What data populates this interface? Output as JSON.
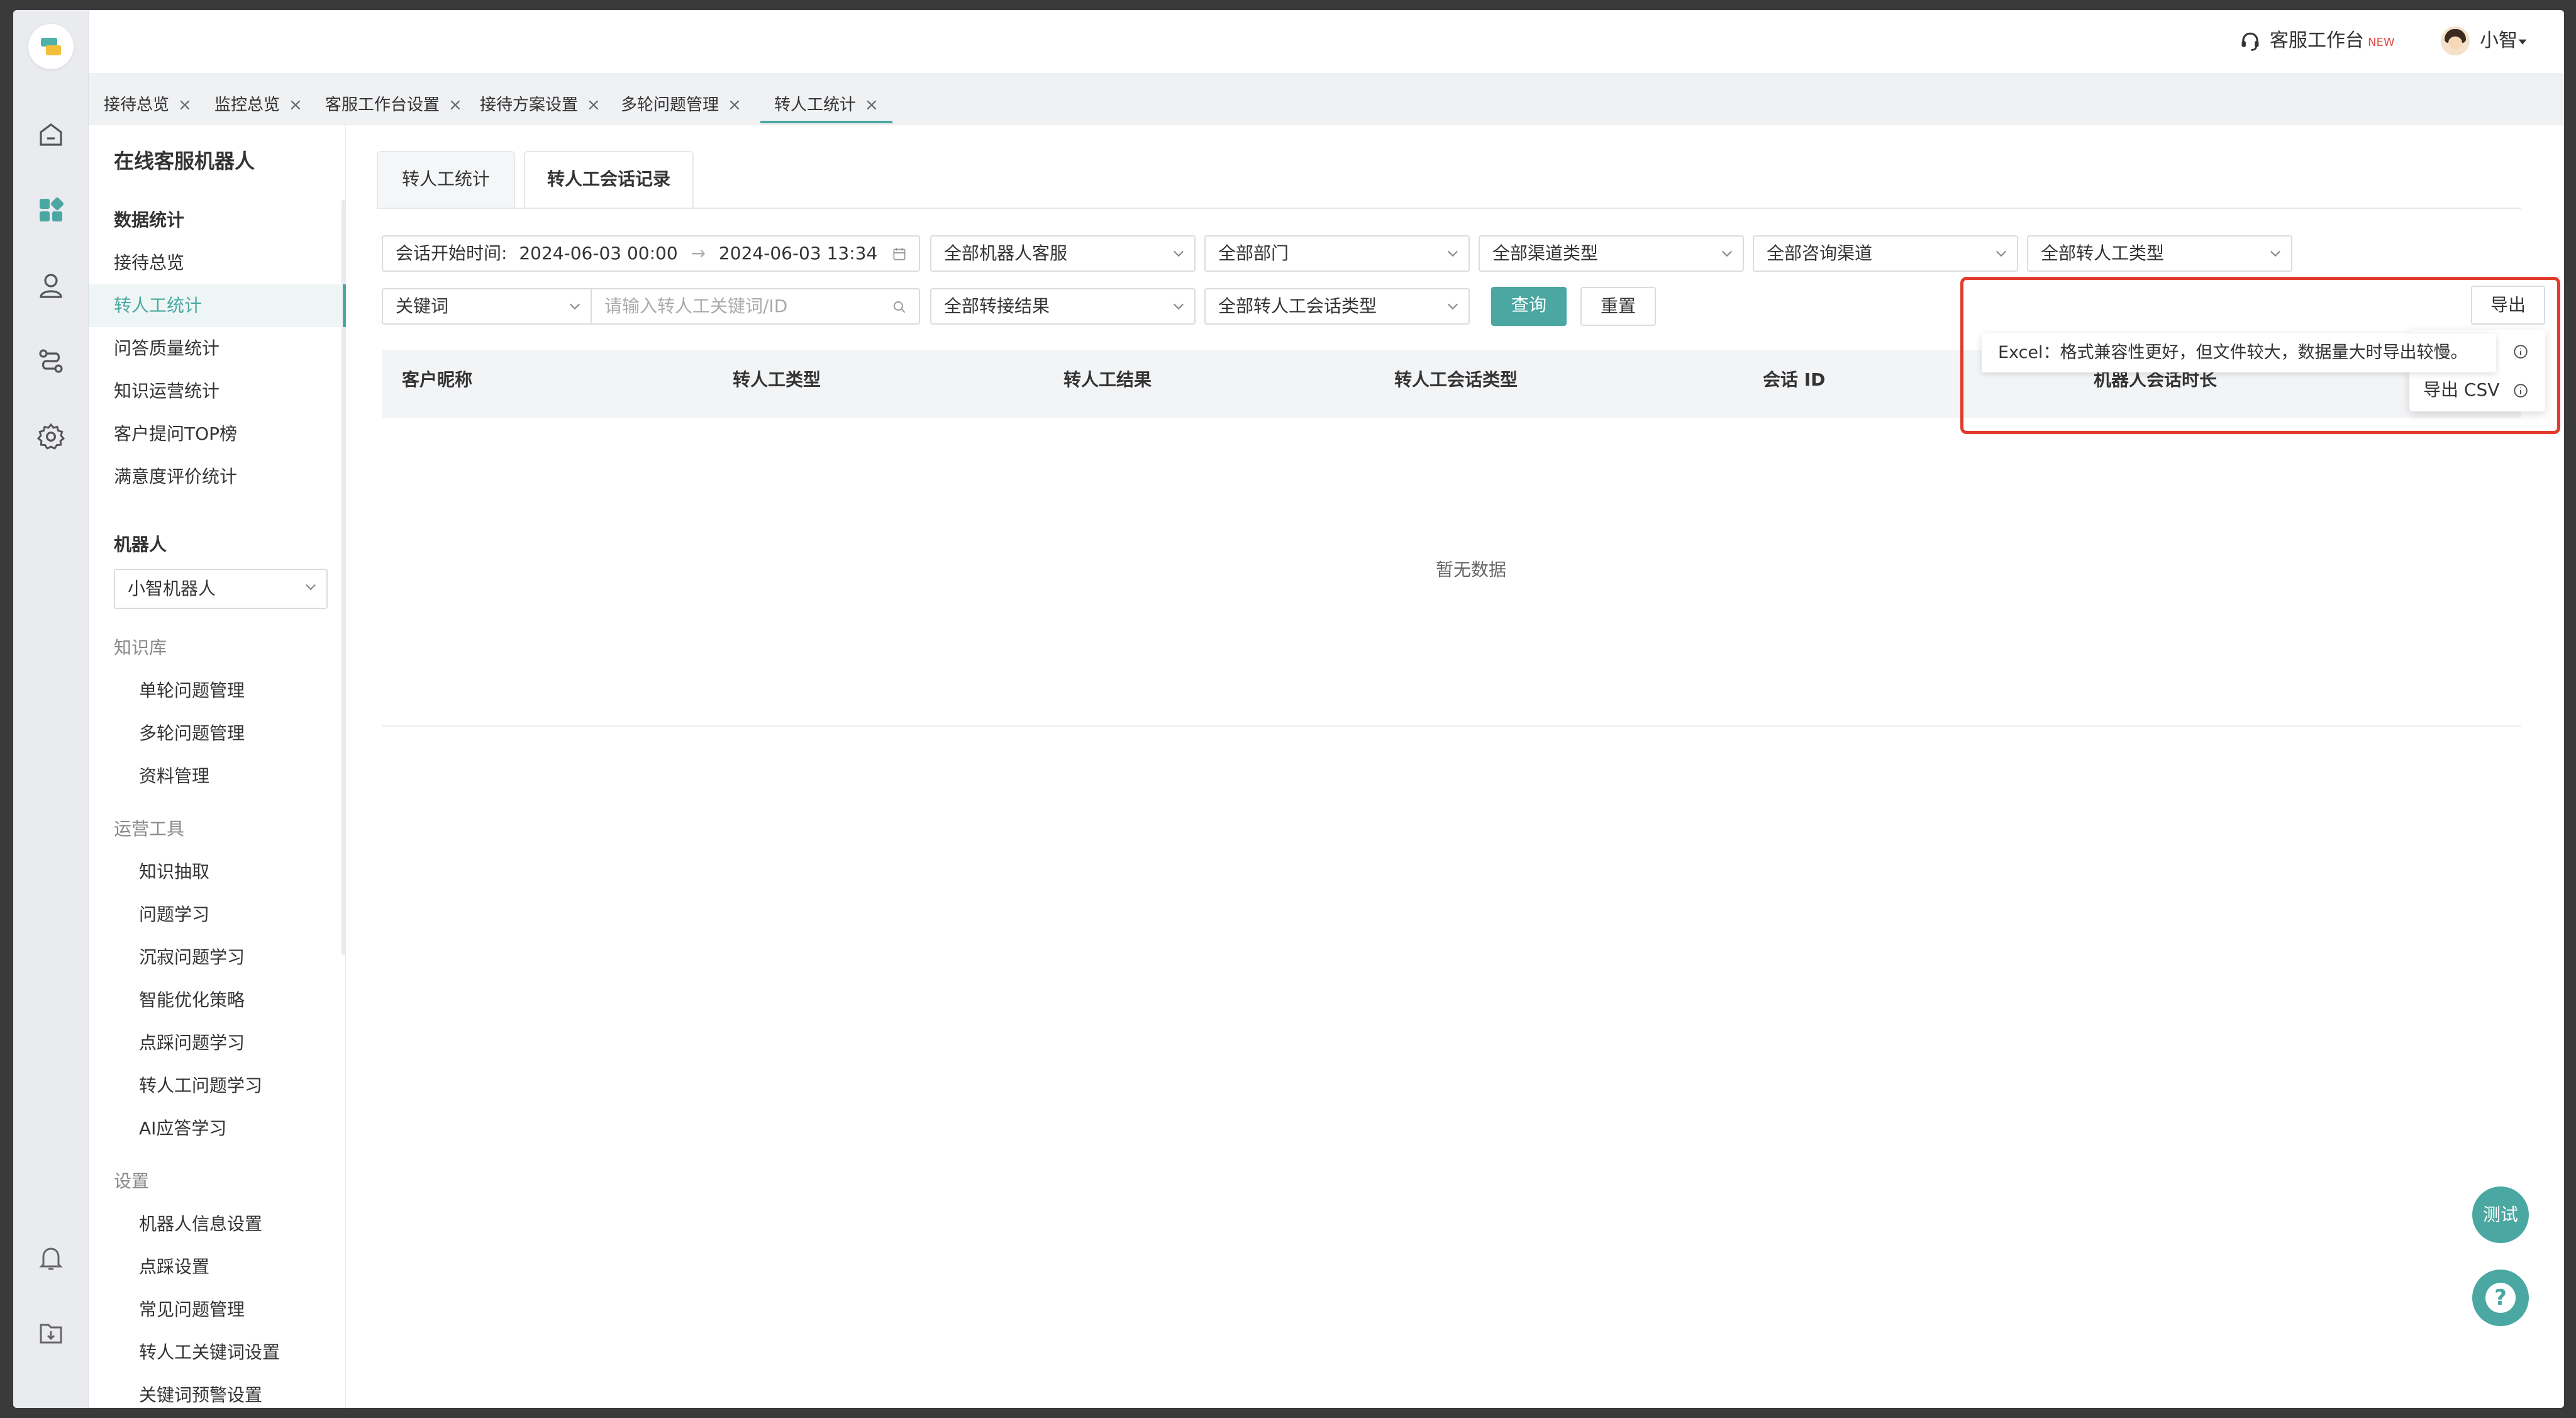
{
  "header": {
    "workbench": "客服工作台",
    "new_badge": "NEW",
    "user_name": "小智"
  },
  "tabs": [
    {
      "label": "接待总览"
    },
    {
      "label": "监控总览"
    },
    {
      "label": "客服工作台设置"
    },
    {
      "label": "接待方案设置"
    },
    {
      "label": "多轮问题管理"
    },
    {
      "label": "转人工统计",
      "active": true
    }
  ],
  "tab_close": "×",
  "sidebar": {
    "title": "在线客服机器人",
    "stats_group": "数据统计",
    "stats_items": [
      "接待总览",
      "转人工统计",
      "问答质量统计",
      "知识运营统计",
      "客户提问TOP榜",
      "满意度评价统计"
    ],
    "robot_group": "机器人",
    "robot_select": "小智机器人",
    "kb_group": "知识库",
    "kb_items": [
      "单轮问题管理",
      "多轮问题管理",
      "资料管理"
    ],
    "ops_group": "运营工具",
    "ops_items": [
      "知识抽取",
      "问题学习",
      "沉寂问题学习",
      "智能优化策略",
      "点踩问题学习",
      "转人工问题学习",
      "AI应答学习"
    ],
    "settings_group": "设置",
    "settings_items": [
      "机器人信息设置",
      "点踩设置",
      "常见问题管理",
      "转人工关键词设置",
      "关键词预警设置"
    ]
  },
  "content_tabs": [
    "转人工统计",
    "转人工会话记录"
  ],
  "filters": {
    "date_label": "会话开始时间:",
    "date_start": "2024-06-03 00:00",
    "date_arrow": "→",
    "date_end": "2024-06-03 13:34",
    "robot_service": "全部机器人客服",
    "department": "全部部门",
    "channel_type": "全部渠道类型",
    "consult_channel": "全部咨询渠道",
    "transfer_type": "全部转人工类型",
    "keyword_type": "关键词",
    "keyword_placeholder": "请输入转人工关键词/ID",
    "transfer_result": "全部转接结果",
    "session_type": "全部转人工会话类型",
    "query": "查询",
    "reset": "重置"
  },
  "export": {
    "button": "导出",
    "tooltip": "Excel：格式兼容性更好，但文件较大，数据量大时导出较慢。",
    "csv": "导出 CSV",
    "partial": "l"
  },
  "table": {
    "columns": [
      "客户昵称",
      "转人工类型",
      "转人工结果",
      "转人工会话类型",
      "会话 ID",
      "机器人会话时长"
    ],
    "empty": "暂无数据"
  },
  "float": {
    "test": "测试",
    "help": "?"
  },
  "colors": {
    "accent": "#4aa7a1",
    "highlight_box": "#e23b2e",
    "new_badge": "#e0504a"
  }
}
